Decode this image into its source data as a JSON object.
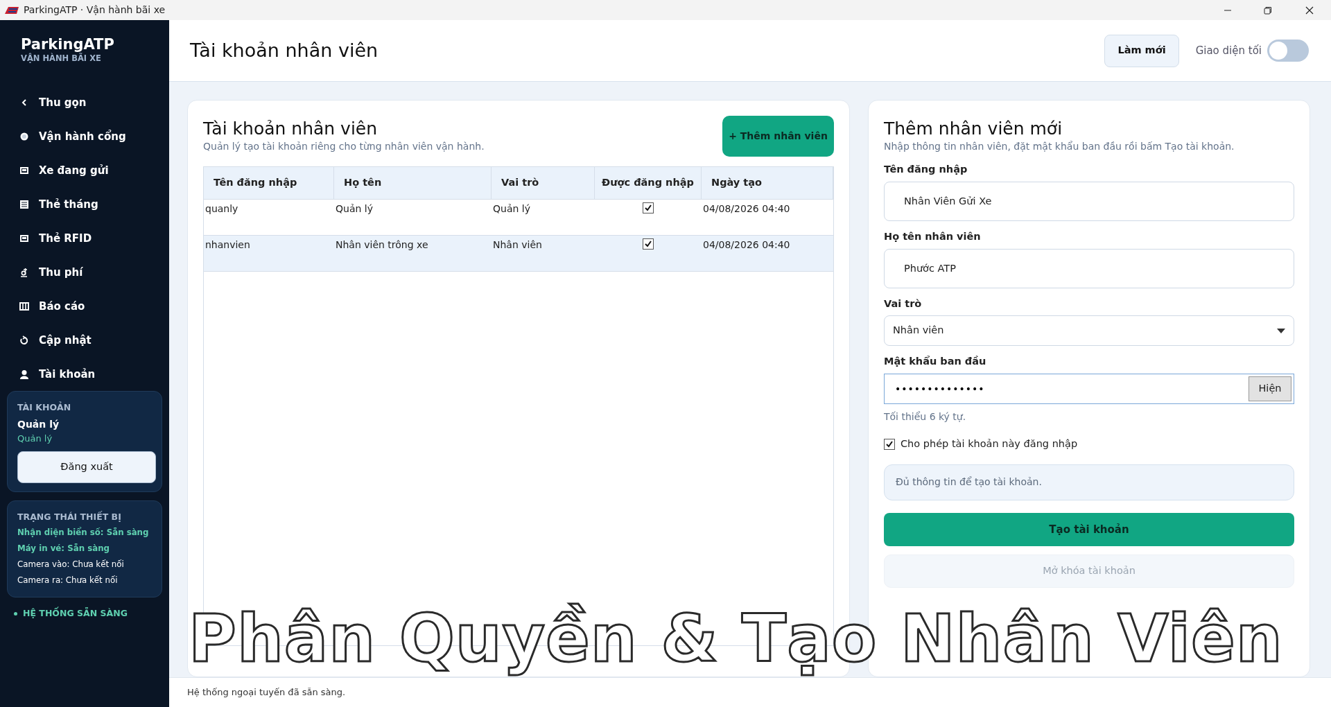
{
  "window": {
    "title": "ParkingATP · Vận hành bãi xe"
  },
  "sidebar": {
    "brand": "ParkingATP",
    "subtitle": "VẬN HÀNH BÃI XE",
    "items": [
      {
        "label": "Thu gọn",
        "selected": false
      },
      {
        "label": "Vận hành cổng",
        "selected": false
      },
      {
        "label": "Xe đang gửi",
        "selected": false
      },
      {
        "label": "Thẻ tháng",
        "selected": false
      },
      {
        "label": "Thẻ RFID",
        "selected": false
      },
      {
        "label": "Thu phí",
        "selected": false
      },
      {
        "label": "Báo cáo",
        "selected": false
      },
      {
        "label": "Cập nhật",
        "selected": false
      },
      {
        "label": "Tài khoản",
        "selected": false
      }
    ],
    "account": {
      "heading": "TÀI KHOẢN",
      "name": "Quản lý",
      "role": "Quản lý",
      "logout": "Đăng xuất"
    },
    "devices": {
      "heading": "TRẠNG THÁI THIẾT BỊ",
      "items": [
        {
          "text": "Nhận diện biển số: Sẵn sàng",
          "ok": true
        },
        {
          "text": "Máy in vé: Sẵn sàng",
          "ok": true
        },
        {
          "text": "Camera vào: Chưa kết nối",
          "ok": false
        },
        {
          "text": "Camera ra: Chưa kết nối",
          "ok": false
        }
      ]
    },
    "system_status": "HỆ THỐNG SẴN SÀNG"
  },
  "header": {
    "title": "Tài khoản nhân viên",
    "refresh": "Làm mới",
    "dark_mode": {
      "label": "Giao diện tối",
      "on": false
    }
  },
  "accounts_panel": {
    "title": "Tài khoản nhân viên",
    "subtitle": "Quản lý tạo tài khoản riêng cho từng nhân viên vận hành.",
    "add_button": "+ Thêm nhân viên",
    "table": {
      "columns": [
        "Tên đăng nhập",
        "Họ tên",
        "Vai trò",
        "Được đăng nhập",
        "Ngày tạo"
      ],
      "rows": [
        {
          "username": "quanly",
          "full_name": "Quản lý",
          "role": "Quản lý",
          "allowed": true,
          "created": "04/08/2026 04:40",
          "selected": false
        },
        {
          "username": "nhanvien",
          "full_name": "Nhân viên trông xe",
          "role": "Nhân viên",
          "allowed": true,
          "created": "04/08/2026 04:40",
          "selected": true
        }
      ]
    }
  },
  "new_panel": {
    "title": "Thêm nhân viên mới",
    "subtitle": "Nhập thông tin nhân viên, đặt mật khẩu ban đầu rồi bấm Tạo tài khoản.",
    "username": {
      "label": "Tên đăng nhập",
      "value": "Nhân Viên Gửi Xe"
    },
    "full_name": {
      "label": "Họ tên nhân viên",
      "value": "Phước ATP"
    },
    "role": {
      "label": "Vai trò",
      "value": "Nhân viên"
    },
    "password": {
      "label": "Mật khẩu ban đầu",
      "value": "••••••••••••••",
      "show_button": "Hiện",
      "hint": "Tối thiểu 6 ký tự."
    },
    "allow_login": {
      "label": "Cho phép tài khoản này đăng nhập",
      "checked": true
    },
    "info": "Đủ thông tin để tạo tài khoản.",
    "create_button": "Tạo tài khoản",
    "unlock_button": {
      "label": "Mở khóa tài khoản",
      "disabled": true
    }
  },
  "status_bar": "Hệ thống ngoại tuyến đã sẵn sàng.",
  "overlay_caption": "Phân Quyền & Tạo Nhân Viên"
}
